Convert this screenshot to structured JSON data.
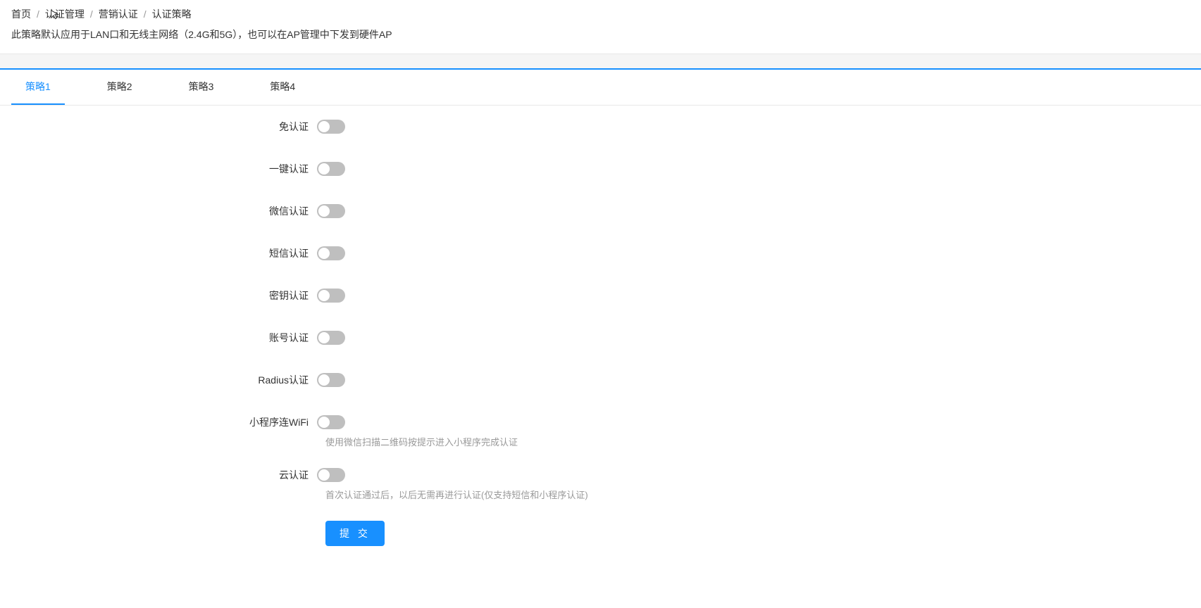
{
  "breadcrumb": {
    "home": "首页",
    "auth_mgmt": "认证管理",
    "marketing_auth": "营销认证",
    "current": "认证策略"
  },
  "description": "此策略默认应用于LAN口和无线主网络（2.4G和5G），也可以在AP管理中下发到硬件AP",
  "tabs": [
    {
      "label": "策略1",
      "active": true
    },
    {
      "label": "策略2",
      "active": false
    },
    {
      "label": "策略3",
      "active": false
    },
    {
      "label": "策略4",
      "active": false
    }
  ],
  "form": {
    "items": [
      {
        "label": "免认证",
        "state": false,
        "desc": ""
      },
      {
        "label": "一键认证",
        "state": false,
        "desc": ""
      },
      {
        "label": "微信认证",
        "state": false,
        "desc": ""
      },
      {
        "label": "短信认证",
        "state": false,
        "desc": ""
      },
      {
        "label": "密钥认证",
        "state": false,
        "desc": ""
      },
      {
        "label": "账号认证",
        "state": false,
        "desc": ""
      },
      {
        "label": "Radius认证",
        "state": false,
        "desc": ""
      },
      {
        "label": "小程序连WiFi",
        "state": false,
        "desc": "使用微信扫描二维码按提示进入小程序完成认证"
      },
      {
        "label": "云认证",
        "state": false,
        "desc": "首次认证通过后，以后无需再进行认证(仅支持短信和小程序认证)"
      }
    ],
    "submit_label": "提 交"
  }
}
